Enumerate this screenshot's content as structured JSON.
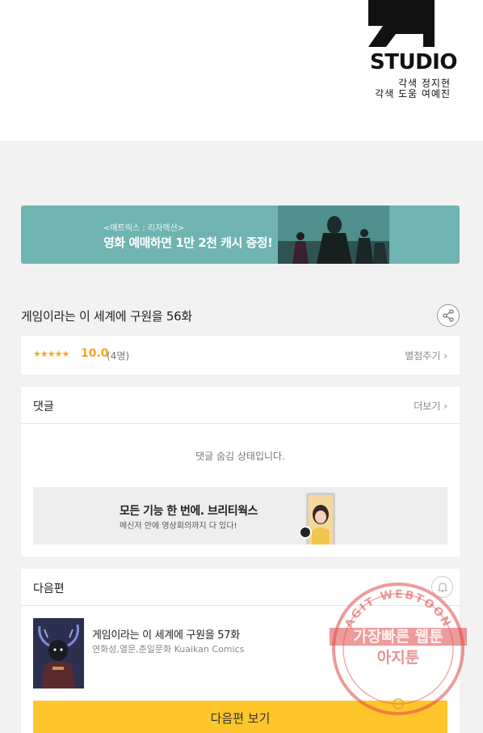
{
  "studio": {
    "name": "STUDIO",
    "credit_line1": "각색 정지현",
    "credit_line2": "각색 도움 여예진"
  },
  "banner": {
    "subtitle": "<매트릭스 : 리저렉션>",
    "title": "영화 예매하면 1만 2천 캐시 증정!"
  },
  "episode": {
    "title": "게임이라는 이 세계에 구원을 56화"
  },
  "rating": {
    "stars": "★★★★★",
    "score": "10.0",
    "count": "(4명)",
    "rate_label": "별점주기 ›"
  },
  "comments": {
    "title": "댓글",
    "more_label": "더보기 ›",
    "hidden_message": "댓글 숨김 상태입니다."
  },
  "ad": {
    "title": "모든 기능 한 번에. 브리티웍스",
    "subtitle": "메신저 안에 영상회의까지 다 있다!"
  },
  "next_episode": {
    "section_title": "다음편",
    "title": "게임이라는 이 세계에 구원을 57화",
    "authors": "연화성,열문,춘일문화 Kuaikan Comics",
    "button_label": "다음편 보기"
  },
  "watermark": {
    "top_arc": "AGIT WEBTOON",
    "line1": "가장빠른 웹툰",
    "line2": "아지툰"
  },
  "colors": {
    "accent_yellow": "#fec62b",
    "star_orange": "#f5a623",
    "banner_teal": "#6fb4b0",
    "stamp_red": "#e04848"
  }
}
